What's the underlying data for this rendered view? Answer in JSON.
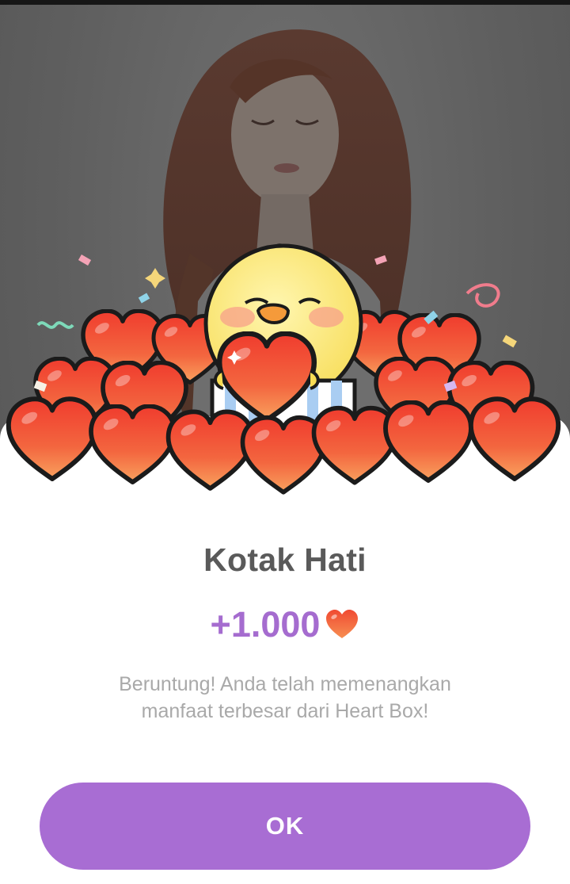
{
  "dialog": {
    "title": "Kotak Hati",
    "reward_amount": "+1.000",
    "reward_icon": "heart-icon",
    "message_line1": "Beruntung! Anda telah memenangkan",
    "message_line2": "manfaat terbesar dari Heart Box!",
    "ok_label": "OK"
  },
  "background": {
    "content": "profile photo of a woman with long wavy auburn hair, dimmed by a dark overlay"
  },
  "illustration": {
    "subject": "yellow chick holding a heart, sitting in a striped gift box surrounded by hearts and confetti"
  },
  "colors": {
    "accent": "#a86dd3",
    "reward_text": "#a56ccf",
    "title_text": "#5a5a5a",
    "body_text": "#a9a9a9",
    "heart": "#f25a3c",
    "overlay": "#5f5f5f"
  }
}
